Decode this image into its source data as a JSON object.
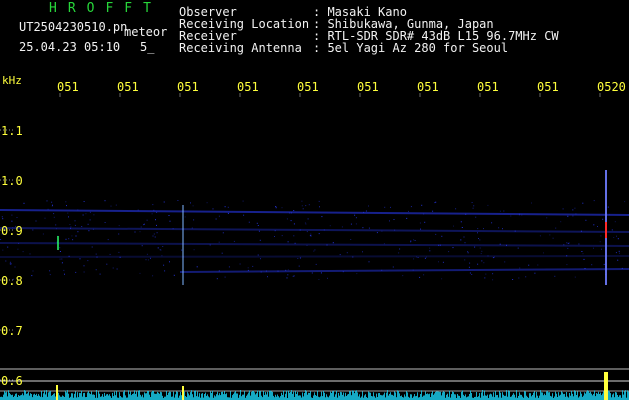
{
  "header": {
    "program": "HROFFT",
    "filename": "UT2504230510.pn",
    "meteor_label": "meteor",
    "datetime": "25.04.23 05:10",
    "count": "5_",
    "fields": [
      {
        "label": "Observer",
        "value": ": Masaki Kano"
      },
      {
        "label": "Receiving Location",
        "value": ": Shibukawa, Gunma, Japan"
      },
      {
        "label": "Receiver",
        "value": ": RTL-SDR SDR# 43dB L15 96.7MHz CW"
      },
      {
        "label": "Receiving Antenna",
        "value": ": 5el Yagi Az 280 for Seoul"
      }
    ]
  },
  "spectrogram": {
    "unit_label": "kHz",
    "time_ticks": [
      "051",
      "051",
      "051",
      "051",
      "051",
      "051",
      "051",
      "051",
      "051",
      "0520"
    ],
    "freq_ticks": [
      "1.1",
      "1.0",
      "0.9",
      "0.8",
      "0.7",
      "0.6"
    ],
    "colors": {
      "background": "#000000",
      "signal": "#2a3cff",
      "text": "#ffff3c",
      "header": "#f2f2f2",
      "title": "#27d63a",
      "noise": "#19c7e6",
      "hot": "#ff2a2a"
    }
  }
}
